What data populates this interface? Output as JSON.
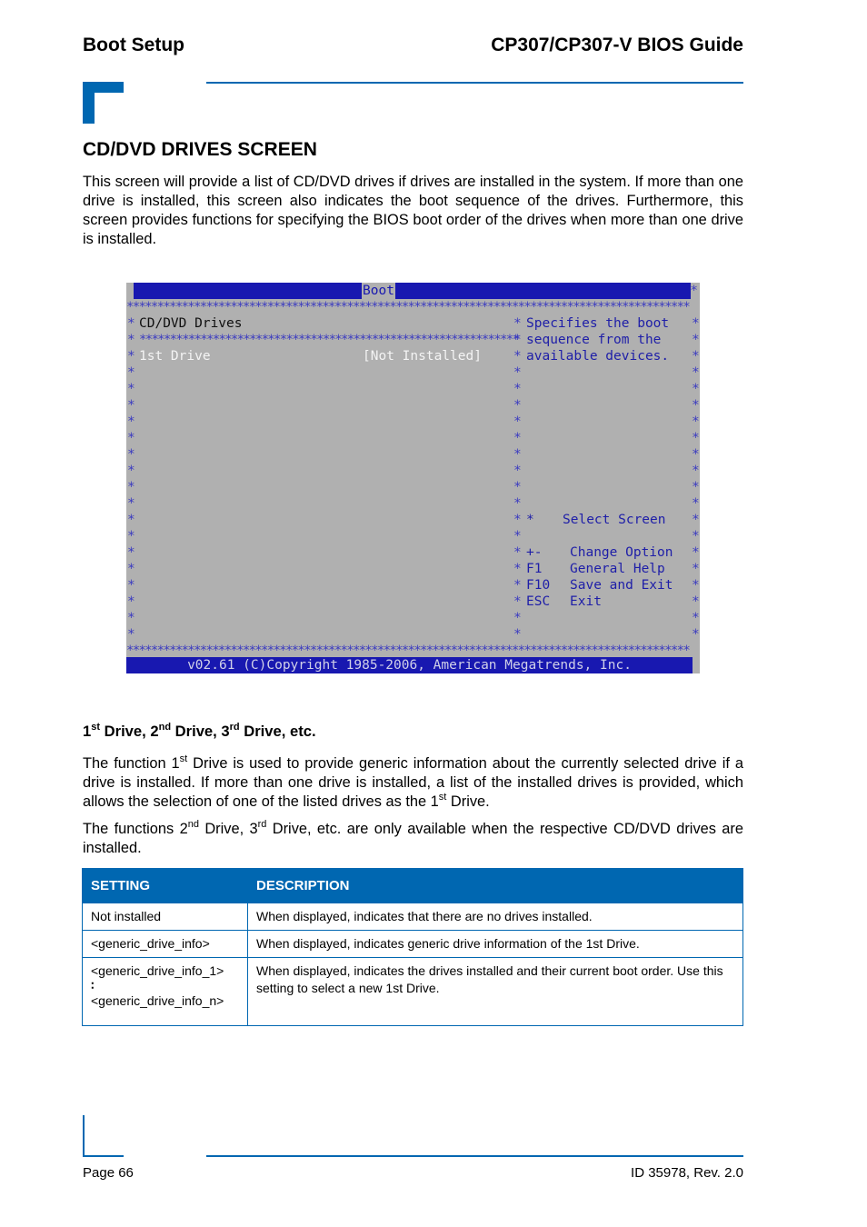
{
  "header": {
    "section": "Boot Setup",
    "guide_title": "CP307/CP307-V BIOS Guide"
  },
  "section_title": "CD/DVD DRIVES SCREEN",
  "intro": "This screen will provide a list of CD/DVD drives if drives are installed in the system. If more than one drive is installed, this screen also indicates the boot sequence of the drives. Furthermore, this screen provides functions for specifying the BIOS boot order of the drives when more than one drive is installed.",
  "bios": {
    "title": "Boot",
    "screen_heading": "CD/DVD Drives",
    "item_label": "1st Drive",
    "item_value": "[Not Installed]",
    "help_lines": [
      "Specifies the boot",
      "sequence from the",
      "available devices."
    ],
    "keys": [
      {
        "key": "↔",
        "action": "Select Screen"
      },
      {
        "key": "+-",
        "action": "Change Option"
      },
      {
        "key": "F1",
        "action": "General Help"
      },
      {
        "key": "F10",
        "action": "Save and Exit"
      },
      {
        "key": "ESC",
        "action": "Exit"
      }
    ],
    "footer": "v02.61 (C)Copyright 1985-2006, American Megatrends, Inc."
  },
  "subsection": {
    "title_parts": [
      "1",
      "st",
      " Drive, 2",
      "nd",
      " Drive, 3",
      "rd",
      " Drive, etc."
    ],
    "para1_parts": [
      "The function 1",
      "st",
      " Drive is used to provide generic information about the currently selected drive if a drive is installed. If more than one drive is installed, a list of the installed drives is provided, which allows the selection of one of the listed drives as the 1",
      "st",
      " Drive."
    ],
    "para2_parts": [
      "The functions 2",
      "nd",
      " Drive, 3",
      "rd",
      " Drive, etc. are only available when the respective CD/DVD drives are installed."
    ]
  },
  "table": {
    "headers": [
      "SETTING",
      "DESCRIPTION"
    ],
    "rows": [
      {
        "setting": "Not installed",
        "description": "When displayed, indicates that there are no drives installed."
      },
      {
        "setting": "<generic_drive_info>",
        "description": "When displayed, indicates generic drive information of the 1st Drive."
      },
      {
        "setting": "<generic_drive_info_1>",
        "setting_end": "<generic_drive_info_n>",
        "ellipsis": "∶",
        "description": "When displayed, indicates the drives installed and their current boot order. Use this setting to select a new 1st Drive."
      }
    ]
  },
  "footer": {
    "page": "Page 66",
    "doc_id": "ID 35978, Rev. 2.0"
  },
  "colors": {
    "accent": "#0067b1",
    "bios_blue": "#1818b0",
    "bios_gray": "#b0b0b0"
  }
}
